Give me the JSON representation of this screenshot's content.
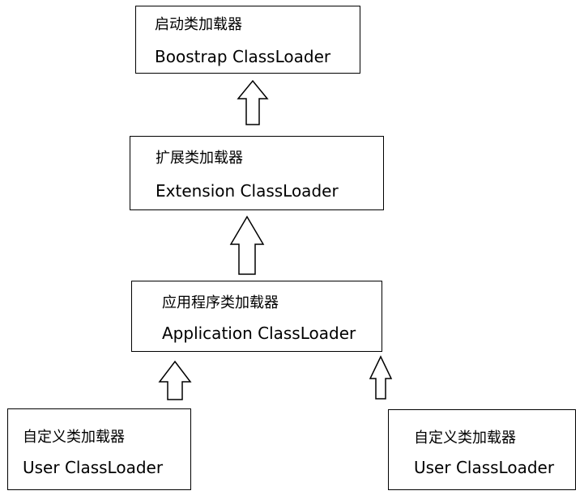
{
  "nodes": {
    "bootstrap": {
      "cn": "启动类加载器",
      "en": "Boostrap ClassLoader"
    },
    "extension": {
      "cn": "扩展类加载器",
      "en": "Extension ClassLoader"
    },
    "application": {
      "cn": "应用程序类加载器",
      "en": "Application ClassLoader"
    },
    "user_left": {
      "cn": "自定义类加载器",
      "en": "User ClassLoader"
    },
    "user_right": {
      "cn": "自定义类加载器",
      "en": "User ClassLoader"
    }
  },
  "colors": {
    "stroke": "#000000",
    "background": "#ffffff"
  },
  "icons": {
    "arrow": "hollow-up-arrow-icon"
  }
}
